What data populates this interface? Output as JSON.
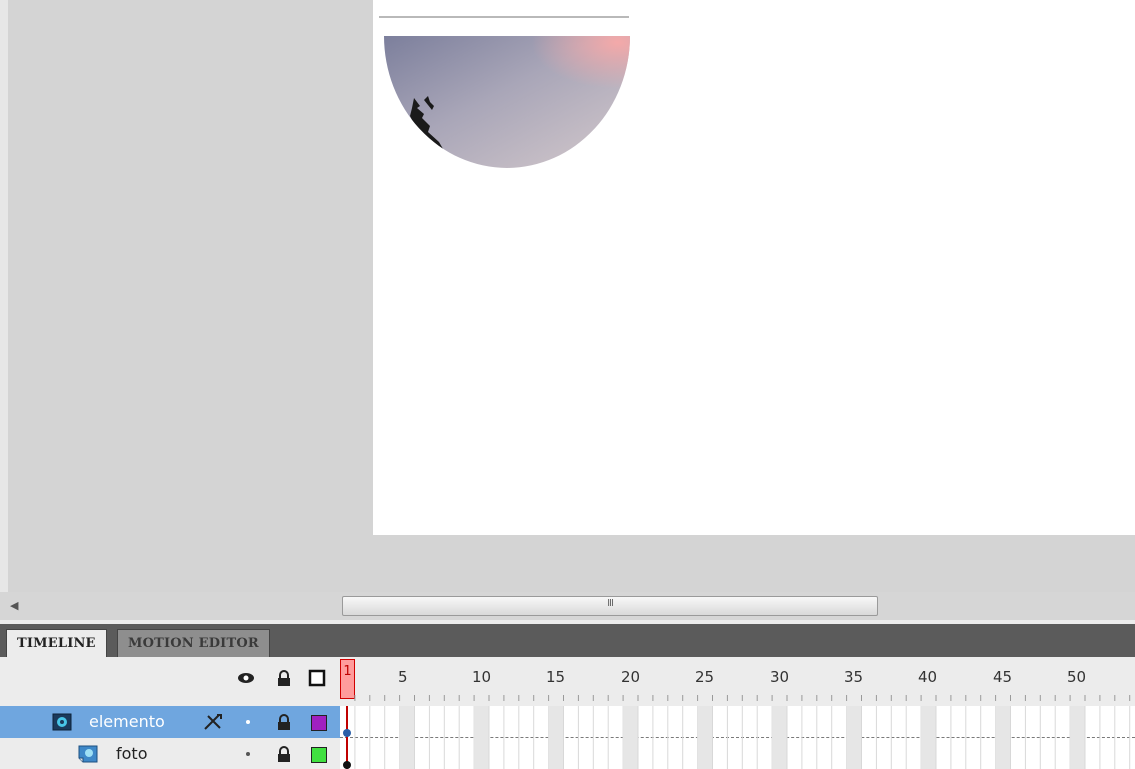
{
  "scrollbar": {
    "grip_label": "III"
  },
  "tabs": {
    "timeline": "TIMELINE",
    "motion_editor": "MOTION EDITOR"
  },
  "frame_numbers": [
    "1",
    "5",
    "10",
    "15",
    "20",
    "25",
    "30",
    "35",
    "40",
    "45",
    "50"
  ],
  "current_frame": "1",
  "layers": [
    {
      "name": "elemento",
      "type": "mask",
      "selected": true,
      "color": "#a020c0"
    },
    {
      "name": "foto",
      "type": "masked",
      "selected": false,
      "color": "#40e040"
    }
  ],
  "colors": {
    "selection": "#6fa6df",
    "playhead": "#d00000",
    "stage": "#ffffff",
    "pasteboard": "#d4d4d4"
  }
}
